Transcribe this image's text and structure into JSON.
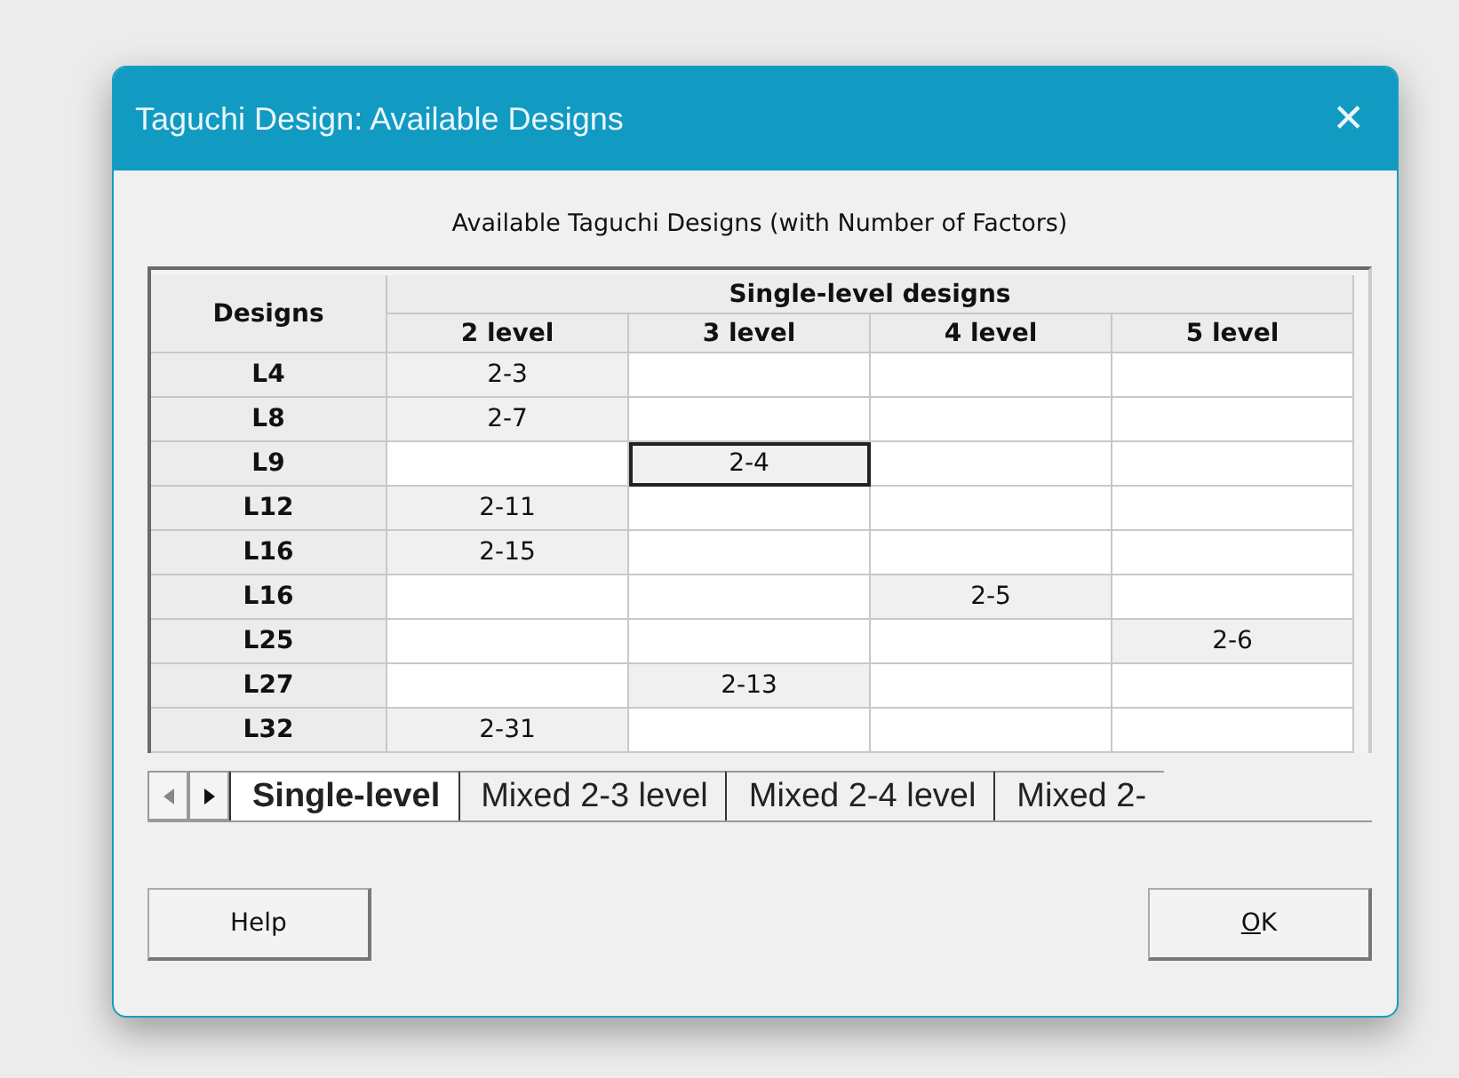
{
  "window": {
    "title": "Taguchi Design: Available Designs",
    "close": "✕"
  },
  "caption": "Available Taguchi Designs (with Number of Factors)",
  "table": {
    "corner_header": "Designs",
    "group_header": "Single-level designs",
    "columns": [
      "2 level",
      "3 level",
      "4 level",
      "5 level"
    ],
    "rows": [
      {
        "design": "L4",
        "cells": [
          {
            "text": "2-3",
            "selected": false
          },
          {
            "selected": false
          },
          {
            "selected": false
          },
          {
            "selected": false
          }
        ]
      },
      {
        "design": "L8",
        "cells": [
          {
            "text": "2-7",
            "selected": false
          },
          {
            "selected": false
          },
          {
            "selected": false
          },
          {
            "selected": false
          }
        ]
      },
      {
        "design": "L9",
        "cells": [
          {
            "selected": false
          },
          {
            "text": "2-4",
            "selected": true
          },
          {
            "selected": false
          },
          {
            "selected": false
          }
        ]
      },
      {
        "design": "L12",
        "cells": [
          {
            "text": "2-11",
            "selected": false
          },
          {
            "selected": false
          },
          {
            "selected": false
          },
          {
            "selected": false
          }
        ]
      },
      {
        "design": "L16",
        "cells": [
          {
            "text": "2-15",
            "selected": false
          },
          {
            "selected": false
          },
          {
            "selected": false
          },
          {
            "selected": false
          }
        ]
      },
      {
        "design": "L16",
        "cells": [
          {
            "selected": false
          },
          {
            "selected": false
          },
          {
            "text": "2-5",
            "selected": false
          },
          {
            "selected": false
          }
        ]
      },
      {
        "design": "L25",
        "cells": [
          {
            "selected": false
          },
          {
            "selected": false
          },
          {
            "selected": false
          },
          {
            "text": "2-6",
            "selected": false
          }
        ]
      },
      {
        "design": "L27",
        "cells": [
          {
            "selected": false
          },
          {
            "text": "2-13",
            "selected": false
          },
          {
            "selected": false
          },
          {
            "selected": false
          }
        ]
      },
      {
        "design": "L32",
        "cells": [
          {
            "text": "2-31",
            "selected": false
          },
          {
            "selected": false
          },
          {
            "selected": false
          },
          {
            "selected": false
          }
        ]
      }
    ]
  },
  "tabs": [
    {
      "label": "Single-level",
      "selected": true
    },
    {
      "label": "Mixed 2-3 level",
      "selected": false
    },
    {
      "label": "Mixed 2-4 level",
      "selected": false
    },
    {
      "label": "Mixed 2-",
      "selected": false
    }
  ],
  "buttons": [
    {
      "label": "Help",
      "first_letter_underlined": false
    },
    {
      "label": "OK",
      "first_letter_underlined": true
    }
  ]
}
